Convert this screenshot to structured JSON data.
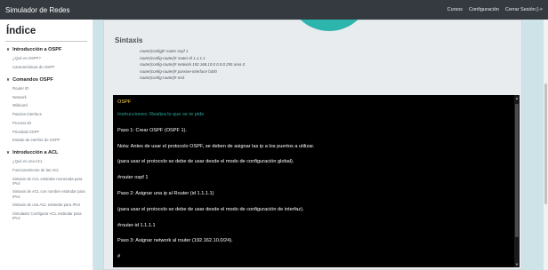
{
  "header": {
    "title": "Simulador de Redes",
    "nav": [
      "Cursos",
      "Configuración",
      "Cerrar Sesión [->"
    ]
  },
  "sidebar": {
    "title": "Índice",
    "sections": [
      {
        "label": "Introducción a OSPF",
        "items": [
          "¿Qué es OSPF?",
          "Características de OSPF"
        ]
      },
      {
        "label": "Comandos OSPF",
        "items": [
          "Router ID",
          "Network",
          "Wildcard",
          "Passive-interface",
          "Process-ID",
          "Prioridad OSPF",
          "Estado de interfaz de OSPF"
        ]
      },
      {
        "label": "Introducción a ACL",
        "items": [
          "¿Qué es una ACL",
          "Funcionamiento de las ACL",
          "Sintaxis de ACL estándar numerada para IPv4",
          "Sintaxis de ACL con nombre estándar para IPv4",
          "Sintaxis de una ACL estándar para IPv4",
          "Simulador Configurar ACL estándar para IPv4"
        ]
      }
    ]
  },
  "content": {
    "sintaxis_title": "Sintaxis",
    "code": [
      "router(config)# router ospf 1",
      "router(config-router)# router-id 1.1.1.1",
      "router(config-router)# network 192.168.10.0 0.0.0.255 area 0",
      "router(config-router)# passive-interface fa0/0",
      "router(config-router)# end"
    ]
  },
  "console": {
    "header": "OSPF",
    "instructions": "Instrucciones: Realiza lo que se te pide",
    "lines": [
      "Paso 1: Crear OSPF (OSPF 1).",
      "Nota: Antes de usar el protocolo OSPF, se deben de asignar las ip a los puertos a utilizar.",
      "(para usar el protocolo se debe de usar desde el modo de configuración global).",
      "#router ospf 1",
      "Paso 2: Asignar una ip al Router (id 1.1.1.1)",
      "(para usar el protocolo se debe de usar desde el modo de configuración de interfaz).",
      "#router-id 1.1.1.1",
      "Paso 3: Asignar network al router (192.162.10.0/24).",
      "#"
    ]
  },
  "colors": {
    "topbar": "#343a40",
    "accent": "#2bb5ad",
    "main_bg": "#cde3e8",
    "console_bg": "#000000",
    "console_header": "#ffd54f",
    "console_instr": "#26a69a"
  },
  "icons": {
    "section_toggle": "chevron-down-icon"
  }
}
